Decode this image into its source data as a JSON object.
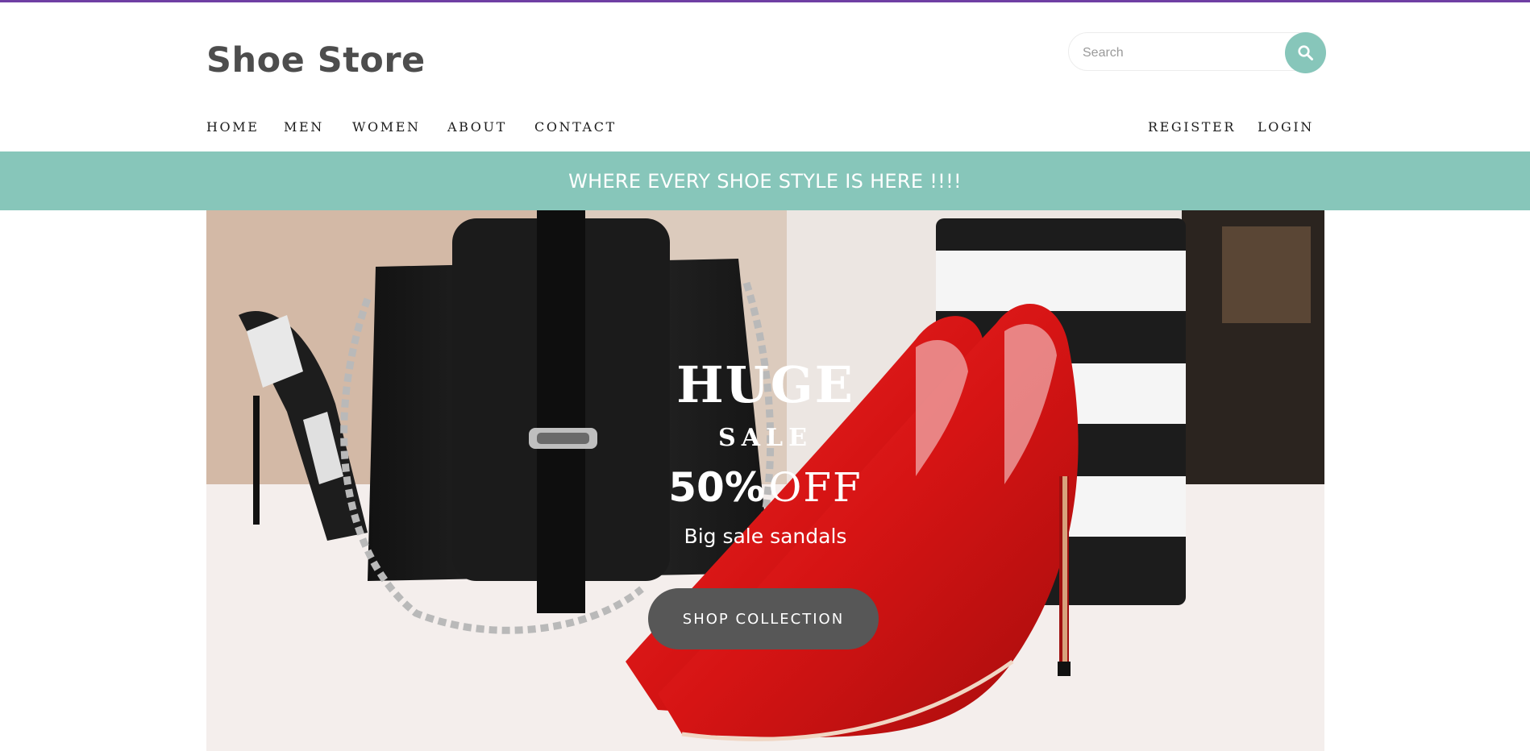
{
  "colors": {
    "accent_top_strip": "#6f3fa3",
    "teal": "#87c6ba",
    "brand_text": "#4d4d4d",
    "button_dark": "#575757"
  },
  "header": {
    "brand": "Shoe Store",
    "search": {
      "placeholder": "Search",
      "value": "",
      "icon": "search-icon"
    }
  },
  "nav": {
    "left": [
      "HOME",
      "MEN",
      "WOMEN",
      "ABOUT",
      "CONTACT"
    ],
    "right": [
      "REGISTER",
      "LOGIN"
    ]
  },
  "banner": {
    "text": "WHERE EVERY SHOE STYLE IS HERE !!!!"
  },
  "hero": {
    "headline": "HUGE",
    "subheadline": "SALE",
    "discount_percent": "50%",
    "discount_word": "OFF",
    "tagline": "Big sale sandals",
    "cta": "SHOP COLLECTION"
  }
}
